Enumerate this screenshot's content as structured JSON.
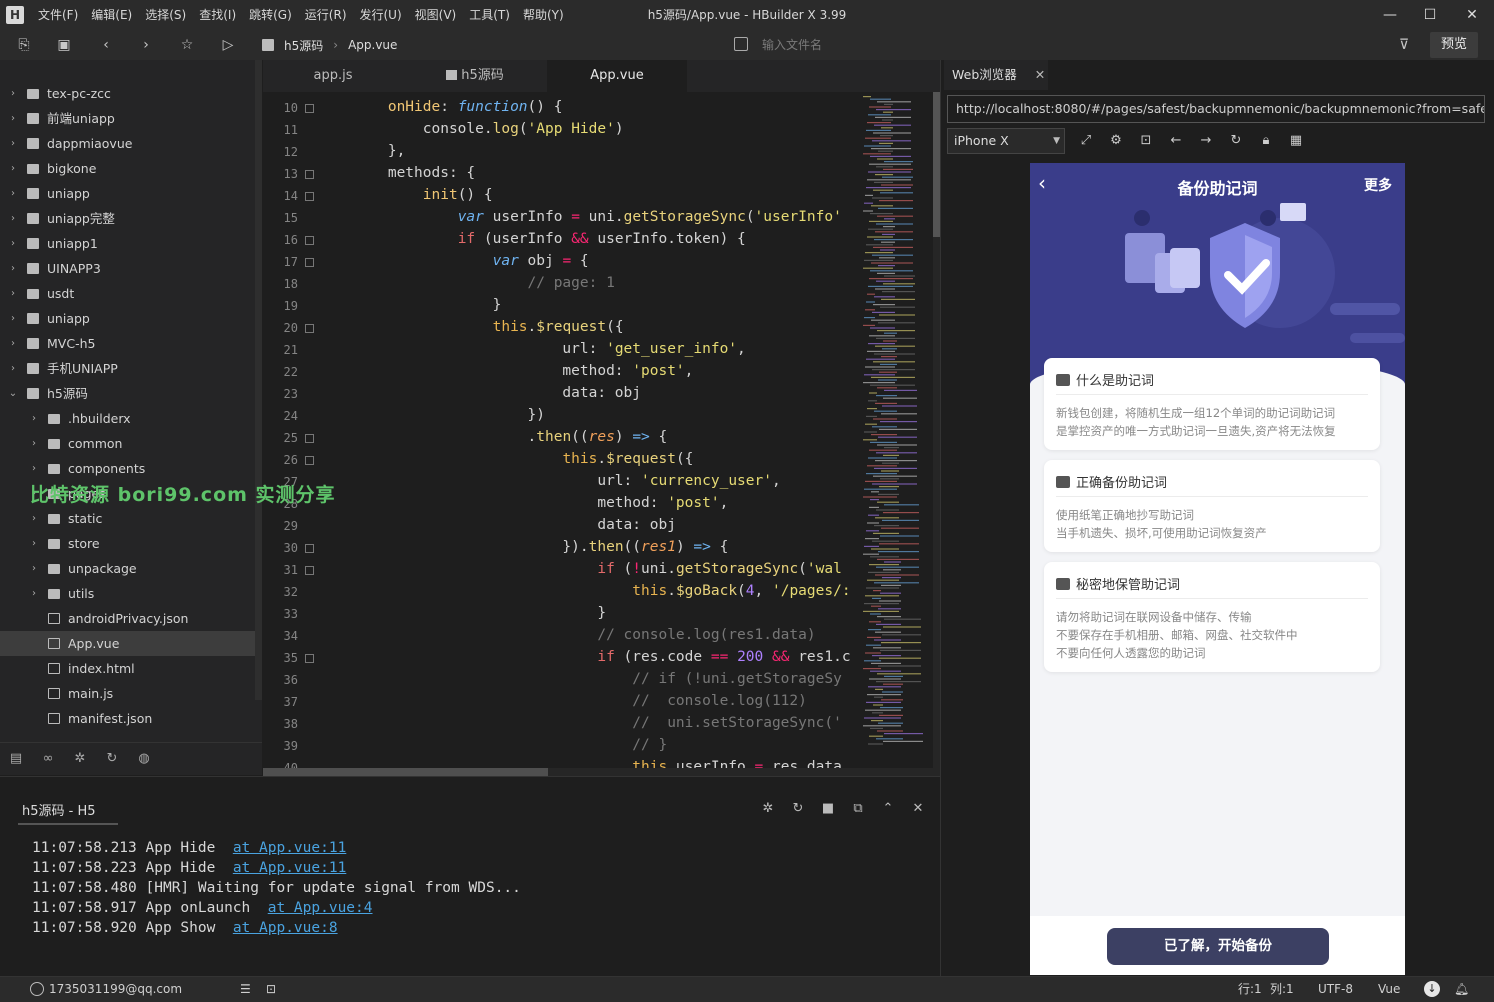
{
  "app": {
    "window_title": "h5源码/App.vue - HBuilder X 3.99",
    "menu": [
      "文件(F)",
      "编辑(E)",
      "选择(S)",
      "查找(I)",
      "跳转(G)",
      "运行(R)",
      "发行(U)",
      "视图(V)",
      "工具(T)",
      "帮助(Y)"
    ],
    "logo_letter": "H"
  },
  "toolbar": {
    "breadcrumb": [
      "h5源码",
      "App.vue"
    ],
    "file_search_placeholder": "输入文件名",
    "preview_label": "预览"
  },
  "sidebar": {
    "items": [
      {
        "label": "tex-pc-zcc",
        "type": "folder",
        "depth": 0,
        "expanded": false
      },
      {
        "label": "前端uniapp",
        "type": "uni",
        "depth": 0,
        "expanded": false
      },
      {
        "label": "dappmiaovue",
        "type": "uni",
        "depth": 0,
        "expanded": false
      },
      {
        "label": "bigkone",
        "type": "folder",
        "depth": 0,
        "expanded": false
      },
      {
        "label": "uniapp",
        "type": "uni",
        "depth": 0,
        "expanded": false
      },
      {
        "label": "uniapp完整",
        "type": "uni",
        "depth": 0,
        "expanded": false
      },
      {
        "label": "uniapp1",
        "type": "uni",
        "depth": 0,
        "expanded": false
      },
      {
        "label": "UINAPP3",
        "type": "uni",
        "depth": 0,
        "expanded": false
      },
      {
        "label": "usdt",
        "type": "folder",
        "depth": 0,
        "expanded": false
      },
      {
        "label": "uniapp",
        "type": "uni",
        "depth": 0,
        "expanded": false
      },
      {
        "label": "MVC-h5",
        "type": "uni",
        "depth": 0,
        "expanded": false
      },
      {
        "label": "手机UNIAPP",
        "type": "uni",
        "depth": 0,
        "expanded": false
      },
      {
        "label": "h5源码",
        "type": "uni",
        "depth": 0,
        "expanded": true
      },
      {
        "label": ".hbuilderx",
        "type": "folder",
        "depth": 1,
        "expanded": false
      },
      {
        "label": "common",
        "type": "folder",
        "depth": 1,
        "expanded": false
      },
      {
        "label": "components",
        "type": "folder",
        "depth": 1,
        "expanded": false
      },
      {
        "label": "pages",
        "type": "folder",
        "depth": 1,
        "expanded": false
      },
      {
        "label": "static",
        "type": "folder",
        "depth": 1,
        "expanded": false
      },
      {
        "label": "store",
        "type": "folder",
        "depth": 1,
        "expanded": false
      },
      {
        "label": "unpackage",
        "type": "folder",
        "depth": 1,
        "expanded": false
      },
      {
        "label": "utils",
        "type": "folder",
        "depth": 1,
        "expanded": false
      },
      {
        "label": "androidPrivacy.json",
        "type": "file-json",
        "depth": 1
      },
      {
        "label": "App.vue",
        "type": "file-vue",
        "depth": 1,
        "selected": true
      },
      {
        "label": "index.html",
        "type": "file-html",
        "depth": 1
      },
      {
        "label": "main.js",
        "type": "file-js",
        "depth": 1
      },
      {
        "label": "manifest.json",
        "type": "file-manifest",
        "depth": 1
      }
    ],
    "bottom_icons": [
      "files-icon",
      "binoculars-icon",
      "bug-icon",
      "git-icon",
      "globe-icon"
    ]
  },
  "editor": {
    "tabs": [
      {
        "label": "app.js",
        "active": false
      },
      {
        "label": "h5源码",
        "active": false
      },
      {
        "label": "App.vue",
        "active": true
      }
    ],
    "lines": [
      {
        "n": "10",
        "fold": true,
        "html": "        <span class=\"k\">onHide</span>: <span class=\"it\">function</span>() {"
      },
      {
        "n": "11",
        "fold": false,
        "html": "            console.<span class=\"fn\">log</span>(<span class=\"st\">'App Hide'</span>)"
      },
      {
        "n": "12",
        "fold": false,
        "html": "        },"
      },
      {
        "n": "13",
        "fold": true,
        "html": "        methods: {"
      },
      {
        "n": "14",
        "fold": true,
        "html": "            <span class=\"k\">init</span>() {"
      },
      {
        "n": "15",
        "fold": false,
        "html": "                <span class=\"it\">var</span> userInfo <span class=\"pr\">=</span> uni.<span class=\"fn\">getStorageSync</span>(<span class=\"st\">'userInfo'</span>"
      },
      {
        "n": "16",
        "fold": true,
        "html": "                <span class=\"kw\">if</span> (userInfo <span class=\"pr\">&amp;&amp;</span> userInfo.token) {"
      },
      {
        "n": "17",
        "fold": true,
        "html": "                    <span class=\"it\">var</span> obj <span class=\"pr\">=</span> {"
      },
      {
        "n": "18",
        "fold": false,
        "html": "                        <span class=\"cm\">// page: 1</span>"
      },
      {
        "n": "19",
        "fold": false,
        "html": "                    }"
      },
      {
        "n": "20",
        "fold": true,
        "html": "                    <span class=\"yl\">this</span>.<span class=\"fn\">$request</span>({"
      },
      {
        "n": "21",
        "fold": false,
        "html": "                            url: <span class=\"st\">'get_user_info'</span>,"
      },
      {
        "n": "22",
        "fold": false,
        "html": "                            method: <span class=\"st\">'post'</span>,"
      },
      {
        "n": "23",
        "fold": false,
        "html": "                            data: obj"
      },
      {
        "n": "24",
        "fold": false,
        "html": "                        })"
      },
      {
        "n": "25",
        "fold": true,
        "html": "                        .<span class=\"fn\">then</span>((<span class=\"it\" style=\"color:#f0a05a\">res</span>) <span class=\"it\">=></span> {"
      },
      {
        "n": "26",
        "fold": true,
        "html": "                            <span class=\"yl\">this</span>.<span class=\"fn\">$request</span>({"
      },
      {
        "n": "27",
        "fold": false,
        "html": "                                url: <span class=\"st\">'currency_user'</span>,"
      },
      {
        "n": "28",
        "fold": false,
        "html": "                                method: <span class=\"st\">'post'</span>,"
      },
      {
        "n": "29",
        "fold": false,
        "html": "                                data: obj"
      },
      {
        "n": "30",
        "fold": true,
        "html": "                            }).<span class=\"fn\">then</span>((<span class=\"it\" style=\"color:#f0a05a\">res1</span>) <span class=\"it\">=></span> {"
      },
      {
        "n": "31",
        "fold": true,
        "html": "                                <span class=\"kw\">if</span> (<span class=\"pr\">!</span>uni.<span class=\"fn\">getStorageSync</span>(<span class=\"st\">'wal</span>"
      },
      {
        "n": "32",
        "fold": false,
        "html": "                                    <span class=\"yl\">this</span>.<span class=\"fn\">$goBack</span>(<span class=\"nm\">4</span>, <span class=\"st\">'/pages/:</span>"
      },
      {
        "n": "33",
        "fold": false,
        "html": "                                }"
      },
      {
        "n": "34",
        "fold": false,
        "html": "                                <span class=\"cm\">// console.log(res1.data)</span>"
      },
      {
        "n": "35",
        "fold": true,
        "html": "                                <span class=\"kw\">if</span> (res.code <span class=\"pr\">==</span> <span class=\"nm\">200</span> <span class=\"pr\">&amp;&amp;</span> res1.c"
      },
      {
        "n": "36",
        "fold": false,
        "html": "                                    <span class=\"cm\">// if (!uni.getStorageSy</span>"
      },
      {
        "n": "37",
        "fold": false,
        "html": "                                    <span class=\"cm\">//  console.log(112)</span>"
      },
      {
        "n": "38",
        "fold": false,
        "html": "                                    <span class=\"cm\">//  uni.setStorageSync('</span>"
      },
      {
        "n": "39",
        "fold": false,
        "html": "                                    <span class=\"cm\">// }</span>"
      },
      {
        "n": "40",
        "fold": false,
        "html": "                                    <span class=\"yl\">this</span>.userInfo <span class=\"pr\">=</span> res.data"
      }
    ]
  },
  "watermark": "比特资源 bori99.com 实测分享",
  "console": {
    "title": "h5源码 - H5",
    "logs": [
      {
        "time": "11:07:58.213",
        "msg": "App Hide",
        "link": "at App.vue:11"
      },
      {
        "time": "11:07:58.223",
        "msg": "App Hide",
        "link": "at App.vue:11"
      },
      {
        "time": "11:07:58.480",
        "msg": "[HMR] Waiting for update signal from WDS...",
        "link": ""
      },
      {
        "time": "11:07:58.917",
        "msg": "App onLaunch",
        "link": "at App.vue:4"
      },
      {
        "time": "11:07:58.920",
        "msg": "App Show",
        "link": "at App.vue:8"
      }
    ]
  },
  "browser": {
    "tab_label": "Web浏览器",
    "url": "http://localhost:8080/#/pages/safest/backupmnemonic/backupmnemonic?from=safest",
    "device": "iPhone X"
  },
  "phone": {
    "title": "备份助记词",
    "more": "更多",
    "back": "‹",
    "cards": [
      {
        "title": "什么是助记词",
        "lines": [
          "新钱包创建，将随机生成一组12个单词的助记词助记词",
          "是掌控资产的唯一方式助记词一旦遗失,资产将无法恢复"
        ]
      },
      {
        "title": "正确备份助记词",
        "lines": [
          "使用纸笔正确地抄写助记词",
          "当手机遗失、损坏,可使用助记词恢复资产"
        ]
      },
      {
        "title": "秘密地保管助记词",
        "lines": [
          "请勿将助记词在联网设备中储存、传输",
          "不要保存在手机相册、邮箱、网盘、社交软件中",
          "不要向任何人透露您的助记词"
        ]
      }
    ],
    "button": "已了解，开始备份"
  },
  "statusbar": {
    "user": "1735031199@qq.com",
    "position_line": "行:1",
    "position_col": "列:1",
    "encoding": "UTF-8",
    "language": "Vue"
  }
}
